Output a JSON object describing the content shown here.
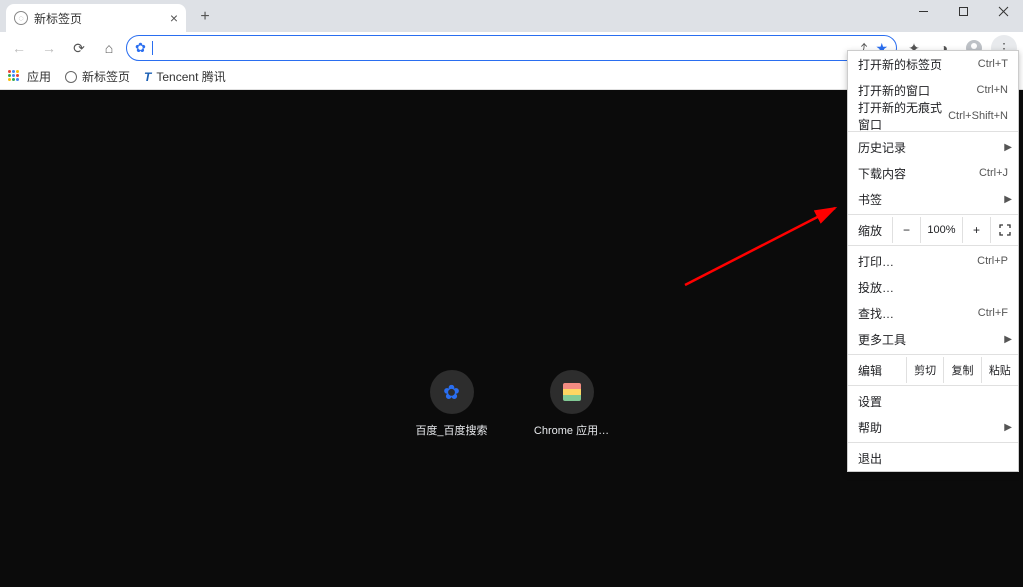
{
  "window": {
    "title": "新标签页"
  },
  "tab": {
    "title": "新标签页"
  },
  "omnibox": {
    "value": "",
    "placeholder": ""
  },
  "bookmarks": {
    "apps": "应用",
    "item1": "新标签页",
    "item2": "Tencent 腾讯"
  },
  "shortcuts": {
    "baidu": "百度_百度搜索",
    "store": "Chrome 应用…"
  },
  "menu": {
    "new_tab": "打开新的标签页",
    "new_tab_kbd": "Ctrl+T",
    "new_window": "打开新的窗口",
    "new_window_kbd": "Ctrl+N",
    "incognito": "打开新的无痕式窗口",
    "incognito_kbd": "Ctrl+Shift+N",
    "history": "历史记录",
    "downloads": "下载内容",
    "downloads_kbd": "Ctrl+J",
    "bookmarks": "书签",
    "zoom_label": "缩放",
    "zoom_value": "100%",
    "print": "打印…",
    "print_kbd": "Ctrl+P",
    "cast": "投放…",
    "find": "查找…",
    "find_kbd": "Ctrl+F",
    "more_tools": "更多工具",
    "edit_label": "编辑",
    "cut": "剪切",
    "copy": "复制",
    "paste": "粘贴",
    "settings": "设置",
    "help": "帮助",
    "exit": "退出"
  }
}
